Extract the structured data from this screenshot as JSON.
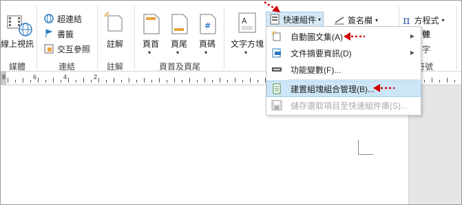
{
  "ribbon": {
    "media": {
      "item": "線上視訊",
      "group": "媒體"
    },
    "links": {
      "items": [
        {
          "label": "超連結",
          "icon": "hyperlink-icon"
        },
        {
          "label": "書籤",
          "icon": "bookmark-icon"
        },
        {
          "label": "交互參照",
          "icon": "cross-reference-icon"
        }
      ],
      "group": "連結"
    },
    "comments": {
      "item": "註解",
      "group": "註解"
    },
    "header_footer": {
      "items": [
        "頁首",
        "頁尾",
        "頁碼"
      ],
      "group": "頁首及頁尾"
    },
    "text": {
      "textbox": "文字方塊",
      "quick_parts": "快速組件",
      "signature_line": "簽名欄",
      "partial_1": "件",
      "partial_2": "字"
    },
    "symbols": {
      "equation": "方程式",
      "partial_1": "號",
      "partial_2": "符號",
      "pi_glyph": "π"
    }
  },
  "ruler": {
    "labels": [
      "8",
      "6",
      "4",
      "2"
    ]
  },
  "menu": {
    "items": [
      {
        "label": "自動圖文集(A)",
        "icon": "autotext-icon",
        "submenu": true,
        "state": "normal"
      },
      {
        "label": "文件摘要資訊(D)",
        "icon": "document-property-icon",
        "submenu": true,
        "state": "normal"
      },
      {
        "label": "功能變數(F)...",
        "icon": "field-icon",
        "submenu": false,
        "state": "normal"
      },
      {
        "label": "建置組塊組合管理(B)...",
        "icon": "building-blocks-organizer-icon",
        "submenu": false,
        "state": "hover"
      },
      {
        "label": "儲存選取項目至快速組件庫(S)...",
        "icon": "save-selection-icon",
        "submenu": false,
        "state": "disabled"
      }
    ]
  },
  "colors": {
    "annotation_red": "#d40000",
    "hover_blue": "#cde6f7"
  }
}
